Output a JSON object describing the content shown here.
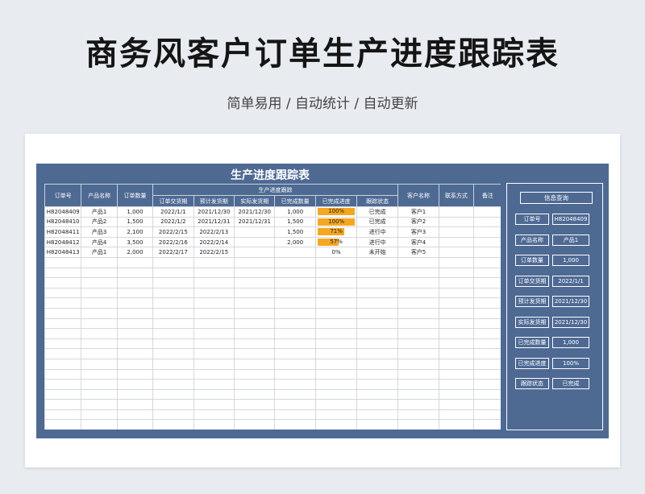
{
  "page": {
    "title": "商务风客户订单生产进度跟踪表",
    "subtitle": "简单易用 / 自动统计 / 自动更新"
  },
  "sheet": {
    "title": "生产进度跟踪表",
    "headers": {
      "order_no": "订单号",
      "product_name": "产品名称",
      "order_qty": "订单数量",
      "group": "生产进度跟踪",
      "delivery_date": "订单交货期",
      "planned_ship": "预计发货期",
      "actual_ship": "实际发货期",
      "completed_qty": "已完成数量",
      "progress": "已完成进度",
      "status": "跟踪状态",
      "customer": "客户名称",
      "contact": "联系方式",
      "notes": "备注"
    },
    "rows": [
      {
        "order_no": "H82048409",
        "product": "产品1",
        "qty": "1,000",
        "delivery": "2022/1/1",
        "planned": "2021/12/30",
        "actual": "2021/12/30",
        "completed": "1,000",
        "progress_label": "100%",
        "progress": 1.0,
        "status": "已完成",
        "customer": "客户1"
      },
      {
        "order_no": "H82048410",
        "product": "产品2",
        "qty": "1,500",
        "delivery": "2022/1/2",
        "planned": "2021/12/31",
        "actual": "2021/12/31",
        "completed": "1,500",
        "progress_label": "100%",
        "progress": 1.0,
        "status": "已完成",
        "customer": "客户2"
      },
      {
        "order_no": "H82048411",
        "product": "产品3",
        "qty": "2,100",
        "delivery": "2022/2/15",
        "planned": "2022/2/13",
        "actual": "",
        "completed": "1,500",
        "progress_label": "71%",
        "progress": 0.71,
        "status": "进行中",
        "customer": "客户3"
      },
      {
        "order_no": "H82048412",
        "product": "产品4",
        "qty": "3,500",
        "delivery": "2022/2/16",
        "planned": "2022/2/14",
        "actual": "",
        "completed": "2,000",
        "progress_label": "57%",
        "progress": 0.57,
        "status": "进行中",
        "customer": "客户4"
      },
      {
        "order_no": "H82048413",
        "product": "产品1",
        "qty": "2,000",
        "delivery": "2022/2/17",
        "planned": "2022/2/15",
        "actual": "",
        "completed": "",
        "progress_label": "0%",
        "progress": 0,
        "status": "未开始",
        "customer": "客户5"
      }
    ],
    "empty_rows": 17
  },
  "info_panel": {
    "title": "信息查询",
    "fields": [
      {
        "label": "订单号",
        "value": "H82048409"
      },
      {
        "label": "产品名称",
        "value": "产品1"
      },
      {
        "label": "订单数量",
        "value": "1,000"
      },
      {
        "label": "订单交货期",
        "value": "2022/1/1"
      },
      {
        "label": "预计发货期",
        "value": "2021/12/30"
      },
      {
        "label": "实际发货期",
        "value": "2021/12/30"
      },
      {
        "label": "已完成数量",
        "value": "1,000"
      },
      {
        "label": "已完成进度",
        "value": "100%"
      },
      {
        "label": "跟踪状态",
        "value": "已完成"
      }
    ]
  },
  "colors": {
    "frame": "#4e6a93",
    "progress_fill": "#f5a720"
  }
}
